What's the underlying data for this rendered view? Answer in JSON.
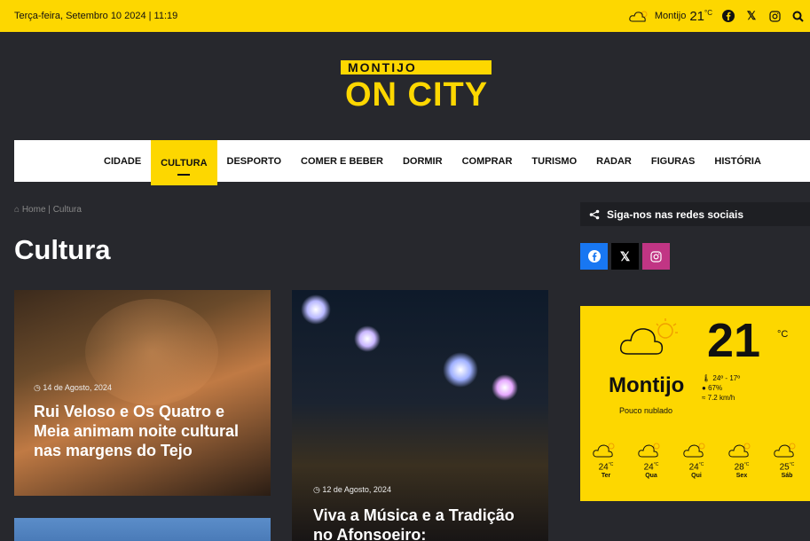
{
  "topbar": {
    "date": "Terça-feira, Setembro 10 2024 | 11:19",
    "weather_city": "Montijo",
    "weather_temp": "21",
    "weather_unit": "°C"
  },
  "logo": {
    "top": "MONTIJO",
    "bottom": "ON CITY"
  },
  "nav": {
    "items": [
      {
        "label": "CIDADE",
        "active": false
      },
      {
        "label": "CULTURA",
        "active": true
      },
      {
        "label": "DESPORTO",
        "active": false
      },
      {
        "label": "COMER E BEBER",
        "active": false
      },
      {
        "label": "DORMIR",
        "active": false
      },
      {
        "label": "COMPRAR",
        "active": false
      },
      {
        "label": "TURISMO",
        "active": false
      },
      {
        "label": "RADAR",
        "active": false
      },
      {
        "label": "FIGURAS",
        "active": false
      },
      {
        "label": "HISTÓRIA",
        "active": false
      }
    ]
  },
  "breadcrumb": {
    "home": "Home",
    "current": "Cultura"
  },
  "page": {
    "title": "Cultura"
  },
  "articles": [
    {
      "date": "14 de Agosto, 2024",
      "title": "Rui Veloso e Os Quatro e Meia animam noite cultural nas margens do Tejo"
    },
    {
      "date": "12 de Agosto, 2024",
      "title": "Viva a Música e a Tradição no Afonsoeiro:"
    }
  ],
  "social": {
    "heading": "Siga-nos nas redes sociais"
  },
  "weather_widget": {
    "temp": "21",
    "unit": "°C",
    "city": "Montijo",
    "description": "Pouco nublado",
    "range": "24º - 17º",
    "humidity": "67%",
    "wind": "7.2 km/h",
    "forecast": [
      {
        "temp": "24",
        "unit": "°C",
        "day": "Ter"
      },
      {
        "temp": "24",
        "unit": "°C",
        "day": "Qua"
      },
      {
        "temp": "24",
        "unit": "°C",
        "day": "Qui"
      },
      {
        "temp": "28",
        "unit": "°C",
        "day": "Sex"
      },
      {
        "temp": "25",
        "unit": "°C",
        "day": "Sáb"
      }
    ]
  },
  "colors": {
    "accent": "#fdd700",
    "background": "#27282d"
  }
}
